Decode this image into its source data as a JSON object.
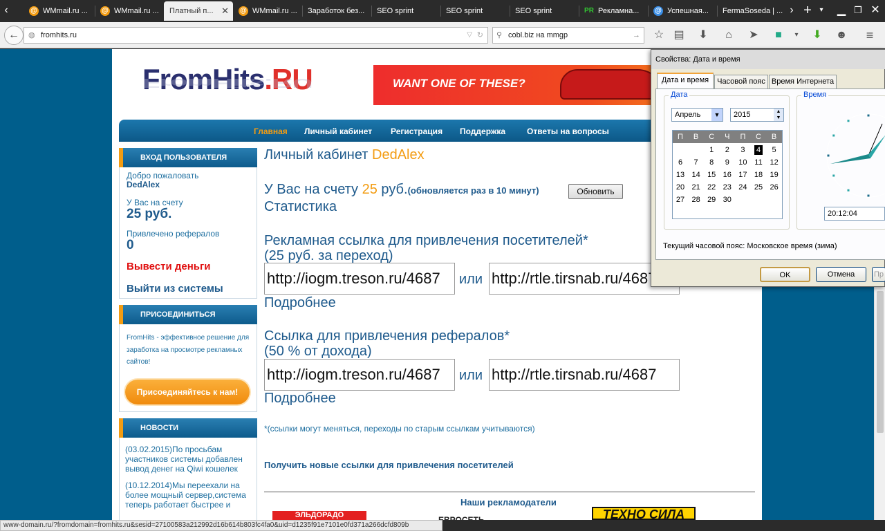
{
  "browser": {
    "tabs": [
      {
        "label": "WMmail.ru ..."
      },
      {
        "label": "WMmail.ru ..."
      },
      {
        "label": "Платный п..."
      },
      {
        "label": "WMmail.ru ..."
      },
      {
        "label": "Заработок без..."
      },
      {
        "label": "SEO sprint"
      },
      {
        "label": "SEO sprint"
      },
      {
        "label": "SEO sprint"
      },
      {
        "label": "Рекламна..."
      },
      {
        "label": "Успешная..."
      },
      {
        "label": "FermaSoseda | ..."
      }
    ],
    "url": "fromhits.ru",
    "search": "cobl.biz на mmgp",
    "status_url": "www-domain.ru/?fromdomain=fromhits.ru&sesid=27100583a212992d16b614b803fc4fa0&uid=d1235f91e7101e0fd371a266dcfd809b"
  },
  "site": {
    "logo_main": "FromHits",
    "logo_ru": ".RU",
    "banner_text": "WANT ONE OF THESE?",
    "menu": [
      "Главная",
      "Личный кабинет",
      "Регистрация",
      "Поддержка",
      "Ответы на вопросы"
    ],
    "sidebar": {
      "login_title": "ВХОД ПОЛЬЗОВАТЕЛЯ",
      "welcome": "Добро пожаловать",
      "username": "DedAlex",
      "balance_label": "У Вас на счету",
      "balance": "25 руб.",
      "referrals_label": "Привлечено рефералов",
      "referrals": "0",
      "withdraw": "Вывести деньги",
      "logout": "Выйти из системы",
      "join_title": "ПРИСОЕДИНИТЬСЯ",
      "join_text": "FromHits - эффективное решение для заработка на просмотре рекламных сайтов!",
      "join_button": "Присоединяйтесь к нам!",
      "news_title": "НОВОСТИ",
      "news": [
        "(03.02.2015)По просьбам участников системы добавлен вывод денег на Qiwi кошелек",
        "(10.12.2014)Мы переехали на более мощный сервер,система теперь работает быстрее и"
      ]
    },
    "main": {
      "cabinet_title": "Личный кабинет ",
      "cabinet_user": "DedAlex",
      "balance_prefix": "У Вас на счету ",
      "balance_value": "25",
      "balance_suffix": " руб.",
      "balance_note": "(обновляется раз в 10 минут)",
      "refresh_button": "Обновить",
      "stats_link": "Статистика",
      "adlink_title": "Рекламная ссылка для привлечения посетителей*",
      "adlink_price": "(25 руб. за переход)",
      "adlink_1": "http://iogm.treson.ru/4687",
      "adlink_2": "http://rtle.tirsnab.ru/4687",
      "or": "или",
      "more": "Подробнее",
      "reflink_title": "Ссылка для привлечения рефералов*",
      "reflink_price": "(50 % от дохода)",
      "reflink_1": "http://iogm.treson.ru/4687",
      "reflink_2": "http://rtle.tirsnab.ru/4687",
      "note": "*(ссылки могут меняться, переходы по старым ссылкам учитываются)",
      "get_new_links": "Получить новые ссылки для привлечения посетителей",
      "advertisers": "Наши рекламодатели",
      "ad_logos": [
        "ЭЛЬДОРАДО",
        "ЕВРОСЕТЬ",
        "ТЕХНО СИЛА"
      ]
    }
  },
  "dialog": {
    "title": "Свойства: Дата и время",
    "tabs": [
      "Дата и время",
      "Часовой пояс",
      "Время Интернета"
    ],
    "date_group": "Дата",
    "time_group": "Время",
    "month": "Апрель",
    "year": "2015",
    "weekdays": [
      "П",
      "В",
      "С",
      "Ч",
      "П",
      "С",
      "В"
    ],
    "days": [
      [
        "",
        "",
        "1",
        "2",
        "3",
        "4",
        "5"
      ],
      [
        "6",
        "7",
        "8",
        "9",
        "10",
        "11",
        "12"
      ],
      [
        "13",
        "14",
        "15",
        "16",
        "17",
        "18",
        "19"
      ],
      [
        "20",
        "21",
        "22",
        "23",
        "24",
        "25",
        "26"
      ],
      [
        "27",
        "28",
        "29",
        "30",
        "",
        "",
        ""
      ]
    ],
    "selected_day": "4",
    "time": "20:12:04",
    "timezone": "Текущий часовой пояс: Московское время (зима)",
    "ok": "OK",
    "cancel": "Отмена",
    "apply": "Пр"
  },
  "colors": {
    "accent": "#f39c12",
    "brand_blue": "#1e5a8c",
    "page_bg": "#005e8c"
  }
}
